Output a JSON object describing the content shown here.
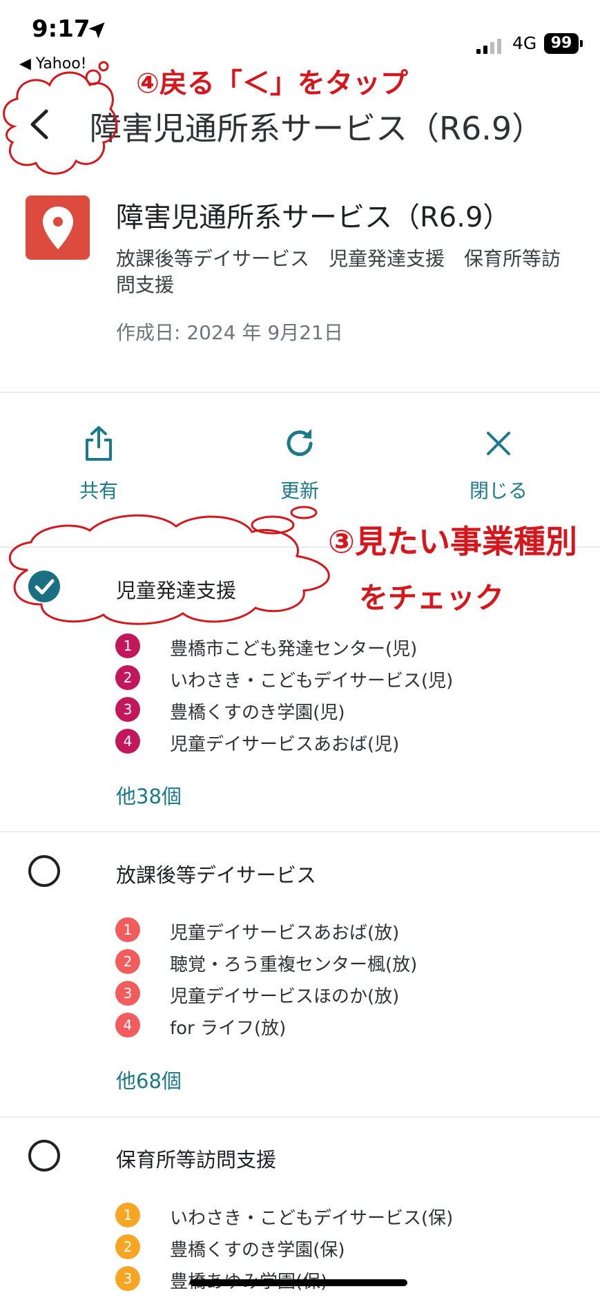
{
  "status_bar": {
    "time": "9:17",
    "back_app": "◀ Yahoo!",
    "network": "4G",
    "battery": "99"
  },
  "header": {
    "title": "障害児通所系サービス（R6.9）"
  },
  "map_info": {
    "name": "障害児通所系サービス（R6.9）",
    "description": "放課後等デイサービス　児童発達支援　保育所等訪問支援",
    "created": "作成日: 2024 年 9月21日",
    "icon": "map-pin-icon",
    "icon_color": "#dd4b3e"
  },
  "actions": [
    {
      "label": "共有",
      "icon": "share-icon"
    },
    {
      "label": "更新",
      "icon": "refresh-icon"
    },
    {
      "label": "閉じる",
      "icon": "close-icon"
    }
  ],
  "layers": [
    {
      "name": "児童発達支援",
      "checked": true,
      "color": "#c2185b",
      "places": [
        {
          "num": "1",
          "name": "豊橋市こども発達センター(児)"
        },
        {
          "num": "2",
          "name": "いわさき・こどもデイサービス(児)"
        },
        {
          "num": "3",
          "name": "豊橋くすのき学園(児)"
        },
        {
          "num": "4",
          "name": "児童デイサービスあおば(児)"
        }
      ],
      "more": "他38個"
    },
    {
      "name": "放課後等デイサービス",
      "checked": false,
      "color": "#f25c5c",
      "places": [
        {
          "num": "1",
          "name": "児童デイサービスあおば(放)"
        },
        {
          "num": "2",
          "name": "聴覚・ろう重複センター楓(放)"
        },
        {
          "num": "3",
          "name": "児童デイサービスほのか(放)"
        },
        {
          "num": "4",
          "name": "for ライフ(放)"
        }
      ],
      "more": "他68個"
    },
    {
      "name": "保育所等訪問支援",
      "checked": false,
      "color": "#f6a623",
      "places": [
        {
          "num": "1",
          "name": "いわさき・こどもデイサービス(保)"
        },
        {
          "num": "2",
          "name": "豊橋くすのき学園(保)"
        },
        {
          "num": "3",
          "name": "豊橋あゆみ学園(保)"
        }
      ]
    }
  ],
  "annotations": {
    "step4": "④戻る「＜」をタップ",
    "step3_line1": "③見たい事業種別",
    "step3_line2": "をチェック",
    "color": "#d6161b"
  }
}
